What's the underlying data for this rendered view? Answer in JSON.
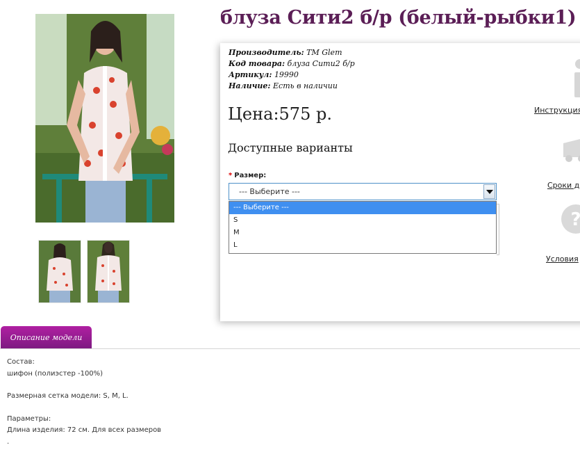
{
  "product": {
    "title": "блуза Сити2 б/р (белый-рыбки1)",
    "info": [
      {
        "label": "Производитель:",
        "value": "TM Glem"
      },
      {
        "label": "Код товара:",
        "value": "блуза Сити2 б/р"
      },
      {
        "label": "Артикул:",
        "value": "19990"
      },
      {
        "label": "Наличие:",
        "value": "Есть в наличии"
      }
    ],
    "price_label": "Цена:",
    "price_value": "575 р.",
    "options_heading": "Доступные варианты",
    "size_label": "Размер:",
    "size_required_mark": "*",
    "size_selected": "--- Выберите ---",
    "size_options": [
      "--- Выберите ---",
      "S",
      "M",
      "L"
    ]
  },
  "side_links": {
    "instruction": "Инструкция",
    "delivery": "Сроки до",
    "terms": "Условия"
  },
  "icons": {
    "info": "info-icon",
    "delivery": "truck-icon",
    "terms": "question-icon"
  },
  "tab": {
    "label": "Описание модели"
  },
  "description": {
    "composition_label": "Состав:",
    "composition_value": "шифон (полиэстер -100%)",
    "sizes_text": "Размерная сетка модели: S, M, L.",
    "params_label": "Параметры:",
    "params_value": "Длина изделия: 72 см. Для всех размеров",
    "tail": "."
  },
  "colors": {
    "title": "#5b1e56",
    "tab": "#9b1d94",
    "select_border": "#4d90c8",
    "option_highlight": "#3f8ff0"
  }
}
